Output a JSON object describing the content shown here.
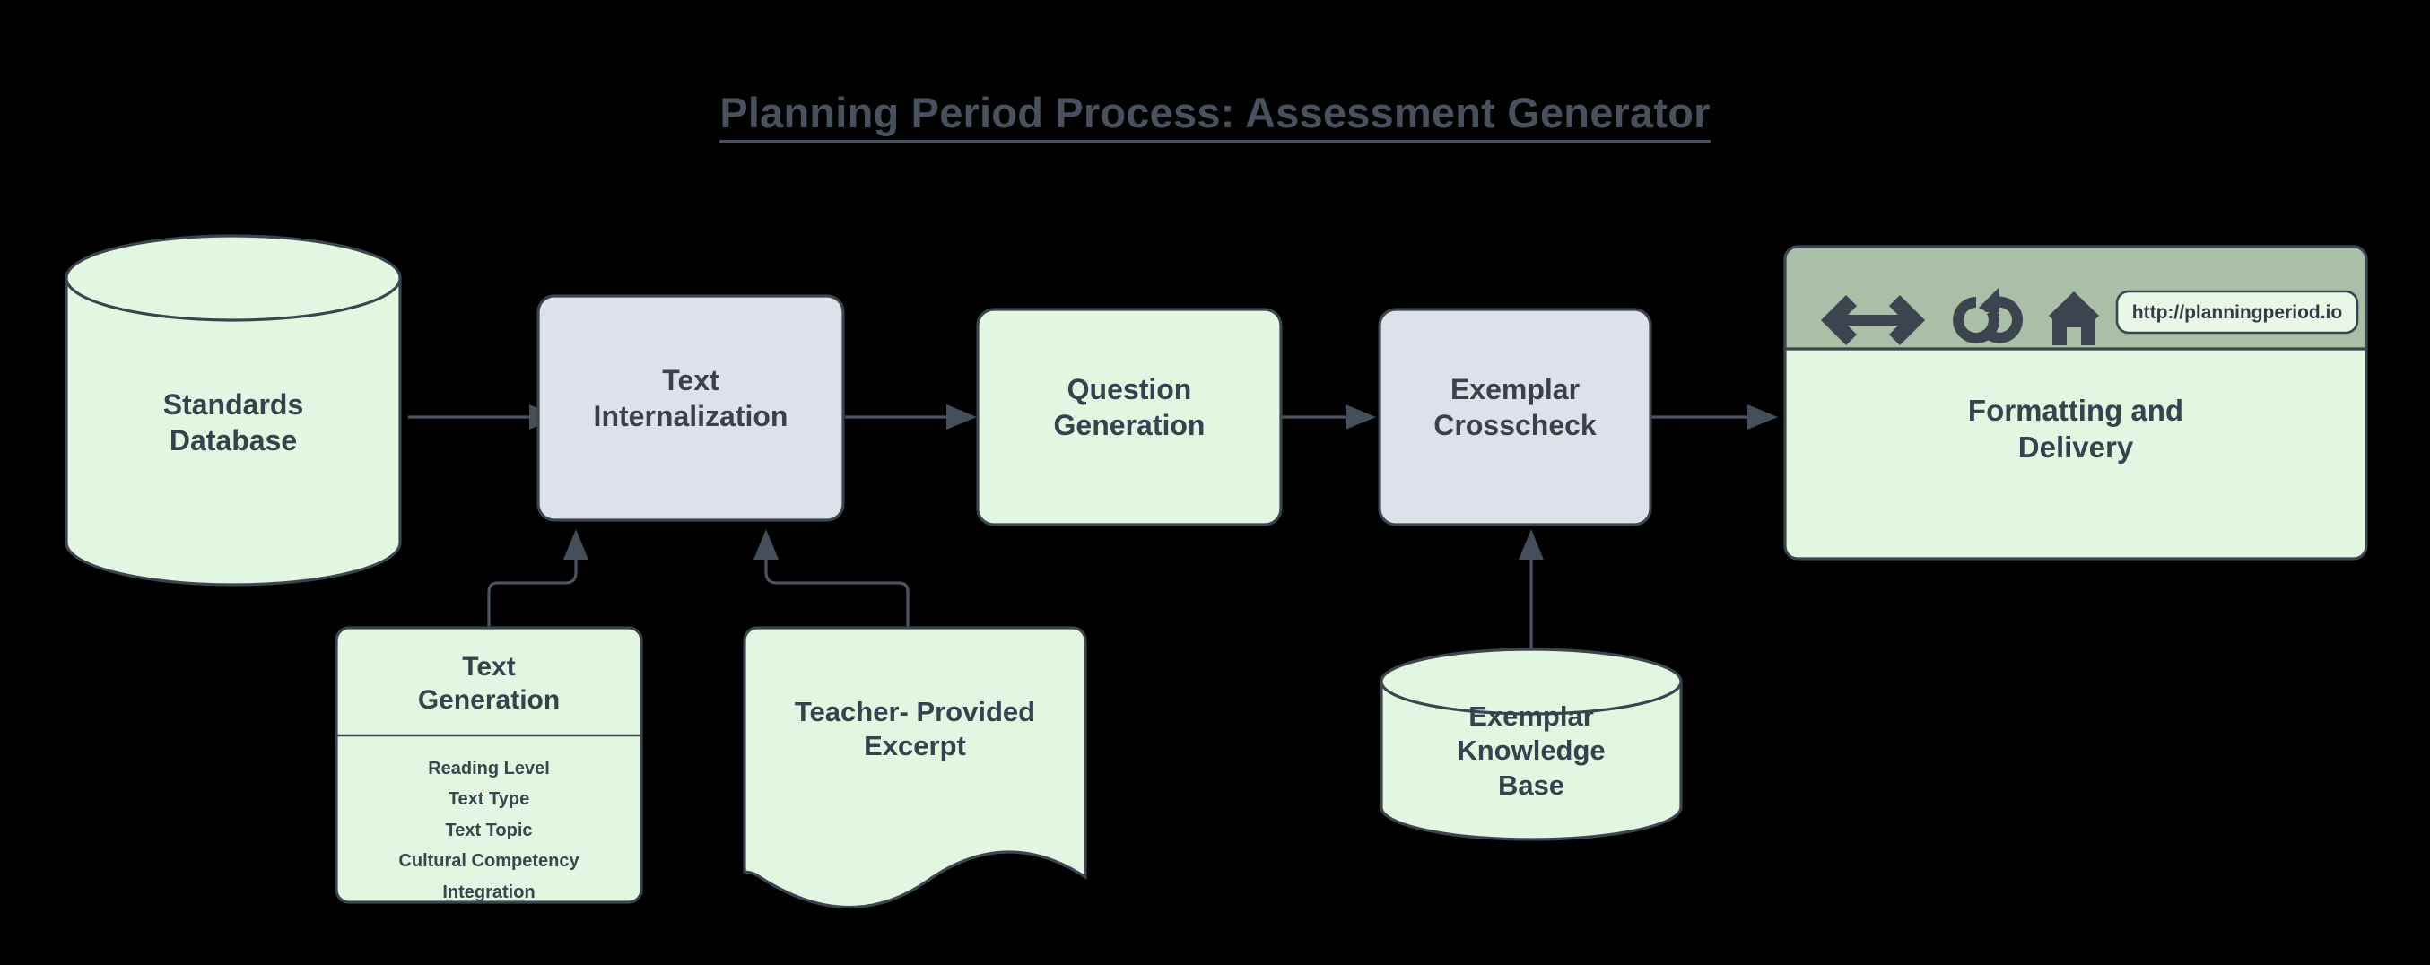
{
  "title": "Planning Period Process: Assessment Generator",
  "background_color": "#000000",
  "palette": {
    "green_fill": "#e2f7e2",
    "gray_fill": "#dee1e7",
    "sage_toolbar": "#aabfa8",
    "stroke": "#3b444f",
    "text": "#38414d",
    "title_text": "#49515e"
  },
  "nodes": {
    "standards_database": {
      "label": "Standards\nDatabase",
      "shape": "cylinder",
      "fill": "green"
    },
    "text_internalization": {
      "label": "Text\nInternalization",
      "shape": "rounded-rect",
      "fill": "gray"
    },
    "question_generation": {
      "label": "Question\nGeneration",
      "shape": "rounded-rect",
      "fill": "green"
    },
    "exemplar_crosscheck": {
      "label": "Exemplar\nCrosscheck",
      "shape": "rounded-rect",
      "fill": "gray"
    },
    "formatting_and_delivery": {
      "label": "Formatting and\nDelivery",
      "shape": "browser-window",
      "fill": "green",
      "url": "http://planningperiod.io",
      "toolbar_icons": [
        "back-arrow-icon",
        "forward-arrow-icon",
        "reload-icon",
        "home-icon"
      ]
    },
    "text_generation": {
      "label": "Text\nGeneration",
      "shape": "class-card",
      "fill": "green",
      "attributes": [
        "Reading Level",
        "Text Type",
        "Text Topic",
        "Cultural Competency",
        "Integration"
      ]
    },
    "teacher_provided_excerpt": {
      "label": "Teacher- Provided\nExcerpt",
      "shape": "document",
      "fill": "green"
    },
    "exemplar_knowledge_base": {
      "label": "Exemplar\nKnowledge\nBase",
      "shape": "cylinder",
      "fill": "green"
    }
  },
  "edges": [
    {
      "from": "standards_database",
      "to": "text_internalization",
      "direction": "right"
    },
    {
      "from": "text_internalization",
      "to": "question_generation",
      "direction": "right"
    },
    {
      "from": "question_generation",
      "to": "exemplar_crosscheck",
      "direction": "right"
    },
    {
      "from": "exemplar_crosscheck",
      "to": "formatting_and_delivery",
      "direction": "right"
    },
    {
      "from": "text_generation",
      "to": "text_internalization",
      "direction": "up-elbow"
    },
    {
      "from": "teacher_provided_excerpt",
      "to": "text_internalization",
      "direction": "up-elbow"
    },
    {
      "from": "exemplar_knowledge_base",
      "to": "exemplar_crosscheck",
      "direction": "up"
    }
  ]
}
